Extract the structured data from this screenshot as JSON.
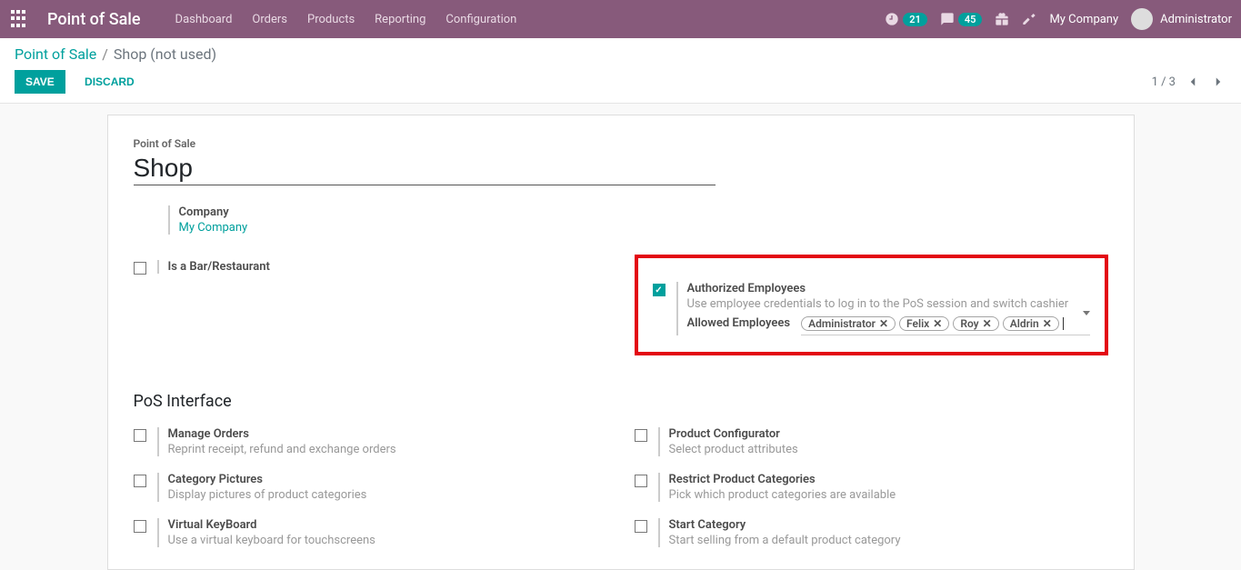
{
  "topnav": {
    "app_title": "Point of Sale",
    "links": [
      "Dashboard",
      "Orders",
      "Products",
      "Reporting",
      "Configuration"
    ],
    "timer_count": "21",
    "msg_count": "45",
    "company": "My Company",
    "user": "Administrator"
  },
  "breadcrumb": {
    "root": "Point of Sale",
    "current": "Shop (not used)"
  },
  "controlbar": {
    "save": "SAVE",
    "discard": "DISCARD",
    "pager": "1 / 3"
  },
  "form": {
    "title_label": "Point of Sale",
    "name": "Shop",
    "company_label": "Company",
    "company_value": "My Company",
    "left_settings": [
      {
        "title": "Is a Bar/Restaurant",
        "desc": "",
        "checked": false
      }
    ],
    "auth_block": {
      "checked": true,
      "title": "Authorized Employees",
      "desc": "Use employee credentials to log in to the PoS session and switch cashier",
      "allowed_label": "Allowed Employees",
      "tags": [
        "Administrator",
        "Felix",
        "Roy",
        "Aldrin"
      ]
    },
    "section_interface": "PoS Interface",
    "interface_left": [
      {
        "title": "Manage Orders",
        "desc": "Reprint receipt, refund and exchange orders"
      },
      {
        "title": "Category Pictures",
        "desc": "Display pictures of product categories"
      },
      {
        "title": "Virtual KeyBoard",
        "desc": "Use a virtual keyboard for touchscreens"
      }
    ],
    "interface_right": [
      {
        "title": "Product Configurator",
        "desc": "Select product attributes"
      },
      {
        "title": "Restrict Product Categories",
        "desc": "Pick which product categories are available"
      },
      {
        "title": "Start Category",
        "desc": "Start selling from a default product category"
      }
    ]
  }
}
